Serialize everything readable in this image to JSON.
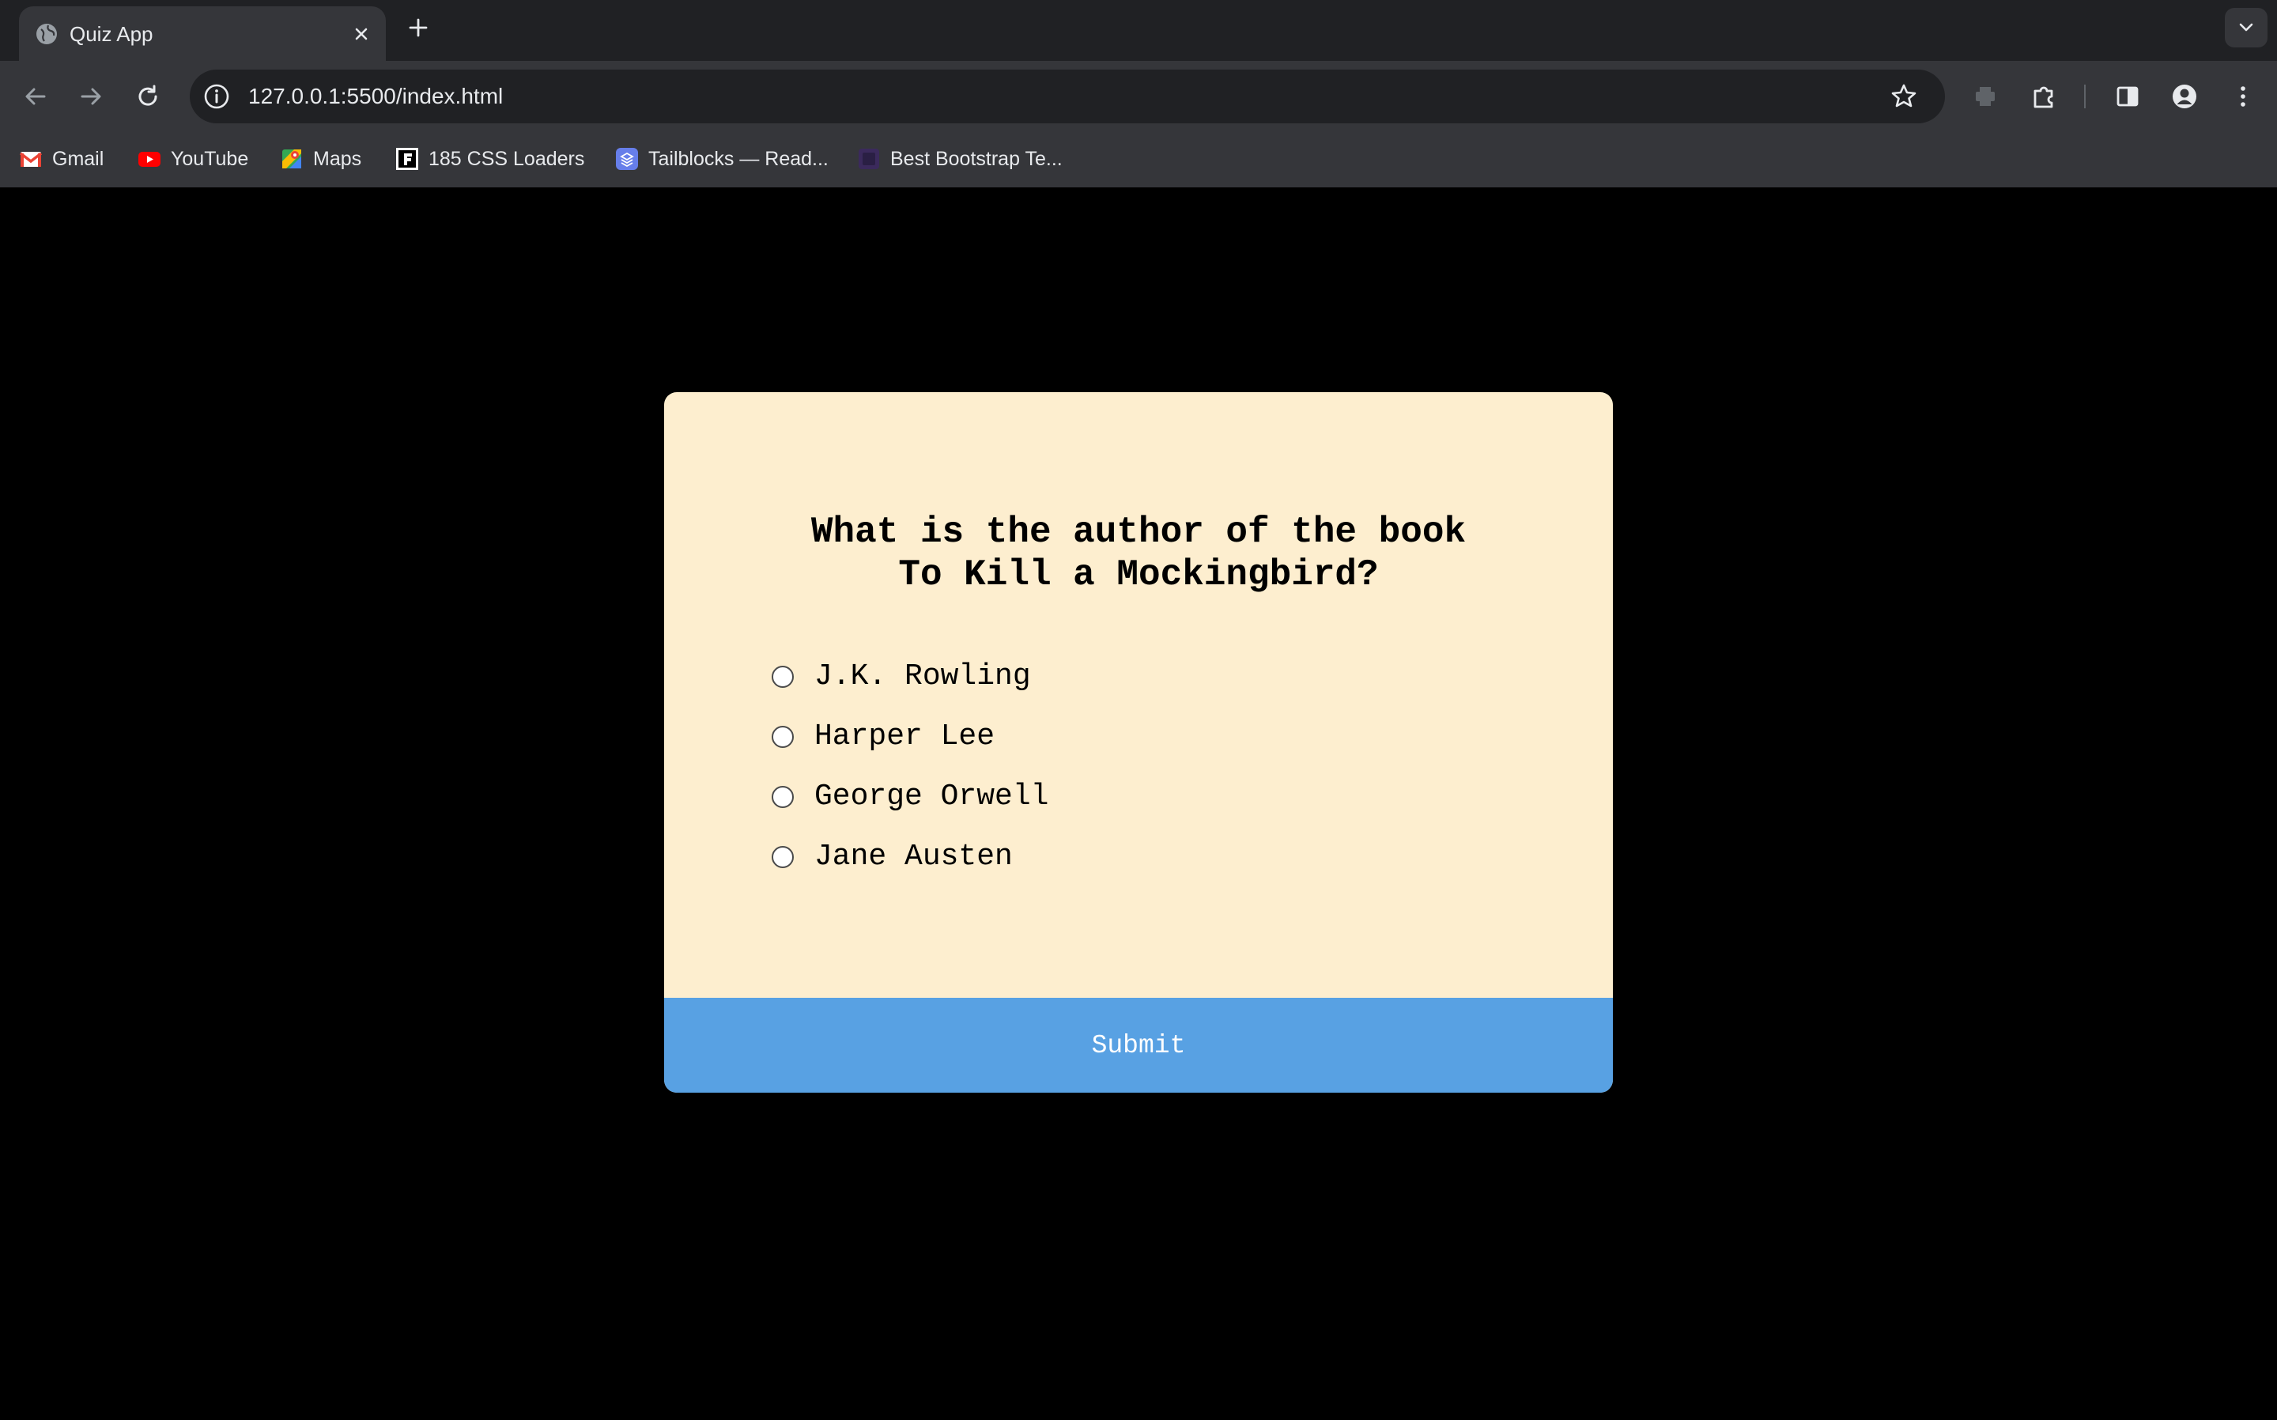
{
  "browser": {
    "tab": {
      "title": "Quiz App"
    },
    "address_bar": {
      "url": "127.0.0.1:5500/index.html"
    },
    "bookmarks": [
      {
        "label": "Gmail",
        "icon": "gmail-icon"
      },
      {
        "label": "YouTube",
        "icon": "youtube-icon"
      },
      {
        "label": "Maps",
        "icon": "maps-icon"
      },
      {
        "label": "185 CSS Loaders",
        "icon": "css-loaders-icon"
      },
      {
        "label": "Tailblocks — Read...",
        "icon": "tailblocks-icon"
      },
      {
        "label": "Best Bootstrap Te...",
        "icon": "bootstrap-icon"
      }
    ]
  },
  "quiz": {
    "question": "What is the author of the book To Kill a Mockingbird?",
    "answers": [
      {
        "label": "J.K. Rowling",
        "selected": false
      },
      {
        "label": "Harper Lee",
        "selected": false
      },
      {
        "label": "George Orwell",
        "selected": false
      },
      {
        "label": "Jane Austen",
        "selected": false
      }
    ],
    "submit_label": "Submit"
  },
  "colors": {
    "page_background": "#000000",
    "card_background": "#fdeecf",
    "submit_background": "#58a1e3",
    "browser_frame": "#202124",
    "toolbar": "#35363a"
  }
}
